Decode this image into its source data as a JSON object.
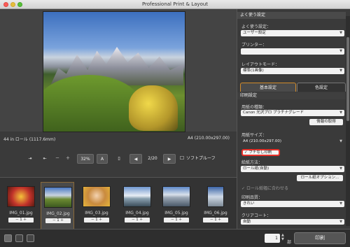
{
  "window": {
    "title": "Professional Print & Layout"
  },
  "preview": {
    "paper_mode": "44 in ロール (1117.6mm)",
    "paper_size": "A4 (210.00x297.00)"
  },
  "toolbar": {
    "zoom": "32%",
    "page": "2/20",
    "soft_proof": "ソフトプルーフ",
    "zoom_out": "－",
    "zoom_in": "＋",
    "prev": "◀",
    "next": "▶",
    "scale_icon": "A"
  },
  "thumbnails": [
    {
      "name": "IMG_01.jpg",
      "count": "1",
      "selected": false
    },
    {
      "name": "IMG_02.jpg",
      "count": "1",
      "selected": true
    },
    {
      "name": "IMG_03.jpg",
      "count": "1",
      "selected": false
    },
    {
      "name": "IMG_04.jpg",
      "count": "1",
      "selected": false
    },
    {
      "name": "IMG_05.jpg",
      "count": "1",
      "selected": false
    },
    {
      "name": "IMG_06.jpg",
      "count": "1",
      "selected": false
    }
  ],
  "settings": {
    "favorites_header": "よく使う設定",
    "favorites_label": "よく使う設定：",
    "favorites_value": "ユーザー設定",
    "printer_label": "プリンター：",
    "printer_value": "",
    "layout_mode_label": "レイアウトモード：",
    "layout_mode_value": "標準(1画像)",
    "tab_basic": "基本設定",
    "tab_color": "色設定",
    "print_settings_header": "印刷設定",
    "media_type_label": "用紙の種類：",
    "media_type_value": "Canon 光沢プロ プラチナグレード",
    "get_info_button": "情報の取得",
    "paper_size_label": "用紙サイズ：",
    "paper_size_value": "A4 (210.00x297.00)",
    "borderless_label": "フチなし印刷",
    "feed_label": "給紙方法：",
    "feed_value": "ロール紙(自動)",
    "roll_options_button": "ロール紙オプション...",
    "fit_roll_label": "ロール紙幅に合わせる",
    "quality_label": "印刷品質：",
    "quality_value": "きれい",
    "coating_label": "クリアコート：",
    "coating_value": "自動"
  },
  "footer": {
    "copies": "1",
    "copies_unit": "部",
    "print_button": "印刷"
  },
  "colors": {
    "highlight": "#e8312a",
    "accent": "#d28b2a"
  }
}
